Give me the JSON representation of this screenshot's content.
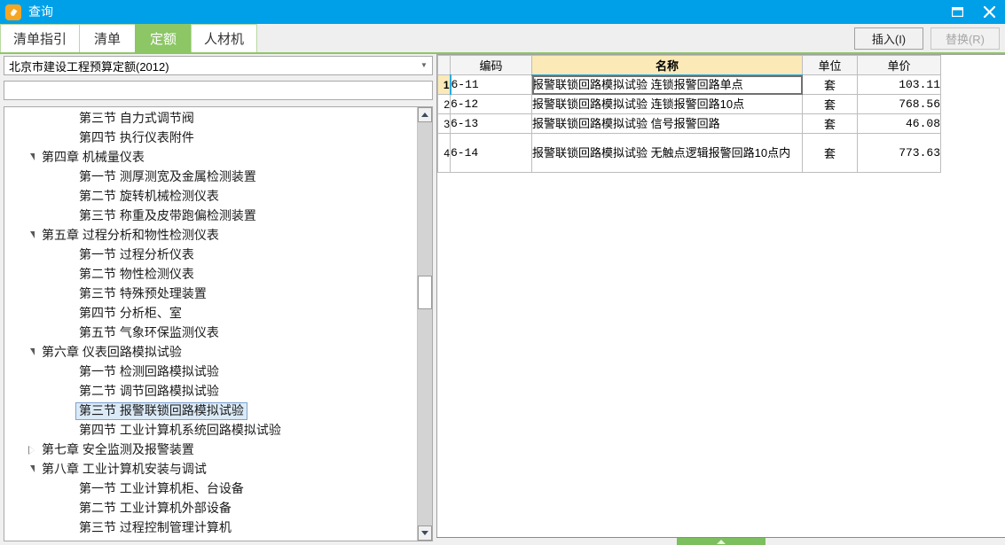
{
  "window": {
    "title": "查询",
    "icon": "app-icon",
    "restore_label": "□",
    "close_label": "✕"
  },
  "tabs": [
    {
      "label": "清单指引",
      "active": false
    },
    {
      "label": "清单",
      "active": false
    },
    {
      "label": "定额",
      "active": true
    },
    {
      "label": "人材机",
      "active": false
    }
  ],
  "toolbar": {
    "insert_label": "插入(I)",
    "replace_label": "替换(R)"
  },
  "left_panel": {
    "standard_select": {
      "value": "北京市建设工程预算定额(2012)",
      "arrow": "▼"
    },
    "search": {
      "value": "",
      "placeholder": ""
    },
    "tree": [
      {
        "label": "第三节 自力式调节阀",
        "level": "section",
        "twist": "none",
        "selected": false
      },
      {
        "label": "第四节 执行仪表附件",
        "level": "section",
        "twist": "none",
        "selected": false
      },
      {
        "label": "第四章 机械量仪表",
        "level": "chapter",
        "twist": "expanded",
        "selected": false
      },
      {
        "label": "第一节 测厚测宽及金属检测装置",
        "level": "section",
        "twist": "none",
        "selected": false
      },
      {
        "label": "第二节 旋转机械检测仪表",
        "level": "section",
        "twist": "none",
        "selected": false
      },
      {
        "label": "第三节 称重及皮带跑偏检测装置",
        "level": "section",
        "twist": "none",
        "selected": false
      },
      {
        "label": "第五章 过程分析和物性检测仪表",
        "level": "chapter",
        "twist": "expanded",
        "selected": false
      },
      {
        "label": "第一节 过程分析仪表",
        "level": "section",
        "twist": "none",
        "selected": false
      },
      {
        "label": "第二节 物性检测仪表",
        "level": "section",
        "twist": "none",
        "selected": false
      },
      {
        "label": "第三节 特殊预处理装置",
        "level": "section",
        "twist": "none",
        "selected": false
      },
      {
        "label": "第四节 分析柜、室",
        "level": "section",
        "twist": "none",
        "selected": false
      },
      {
        "label": "第五节 气象环保监测仪表",
        "level": "section",
        "twist": "none",
        "selected": false
      },
      {
        "label": "第六章 仪表回路模拟试验",
        "level": "chapter",
        "twist": "expanded",
        "selected": false
      },
      {
        "label": "第一节 检测回路模拟试验",
        "level": "section",
        "twist": "none",
        "selected": false
      },
      {
        "label": "第二节 调节回路模拟试验",
        "level": "section",
        "twist": "none",
        "selected": false
      },
      {
        "label": "第三节 报警联锁回路模拟试验",
        "level": "section",
        "twist": "none",
        "selected": true
      },
      {
        "label": "第四节 工业计算机系统回路模拟试验",
        "level": "section",
        "twist": "none",
        "selected": false
      },
      {
        "label": "第七章 安全监测及报警装置",
        "level": "chapter",
        "twist": "collapsed",
        "selected": false
      },
      {
        "label": "第八章 工业计算机安装与调试",
        "level": "chapter",
        "twist": "expanded",
        "selected": false
      },
      {
        "label": "第一节 工业计算机柜、台设备",
        "level": "section",
        "twist": "none",
        "selected": false
      },
      {
        "label": "第二节 工业计算机外部设备",
        "level": "section",
        "twist": "none",
        "selected": false
      },
      {
        "label": "第三节 过程控制管理计算机",
        "level": "section",
        "twist": "none",
        "selected": false
      }
    ]
  },
  "grid": {
    "columns": [
      {
        "key": "rownum",
        "label": "",
        "active": false
      },
      {
        "key": "code",
        "label": "编码",
        "active": false
      },
      {
        "key": "name",
        "label": "名称",
        "active": true
      },
      {
        "key": "unit",
        "label": "单位",
        "active": false
      },
      {
        "key": "price",
        "label": "单价",
        "active": false
      }
    ],
    "rows": [
      {
        "rownum": "1",
        "code": "6-11",
        "name": "报警联锁回路模拟试验  连锁报警回路单点",
        "unit": "套",
        "price": "103.11",
        "current": true,
        "tall": false
      },
      {
        "rownum": "2",
        "code": "6-12",
        "name": "报警联锁回路模拟试验  连锁报警回路10点",
        "unit": "套",
        "price": "768.56",
        "current": false,
        "tall": false
      },
      {
        "rownum": "3",
        "code": "6-13",
        "name": "报警联锁回路模拟试验  信号报警回路",
        "unit": "套",
        "price": "46.08",
        "current": false,
        "tall": false
      },
      {
        "rownum": "4",
        "code": "6-14",
        "name": "报警联锁回路模拟试验  无触点逻辑报警回路10点内",
        "unit": "套",
        "price": "773.63",
        "current": false,
        "tall": true
      }
    ]
  },
  "bottom": {
    "splitter_icon": "chevron-up-icon"
  },
  "colors": {
    "title_bar": "#00a0e9",
    "tab_active": "#8cc665",
    "active_column": "#fbe9b7",
    "selection": "#dbeaf7",
    "splitter": "#7cbf5e"
  }
}
